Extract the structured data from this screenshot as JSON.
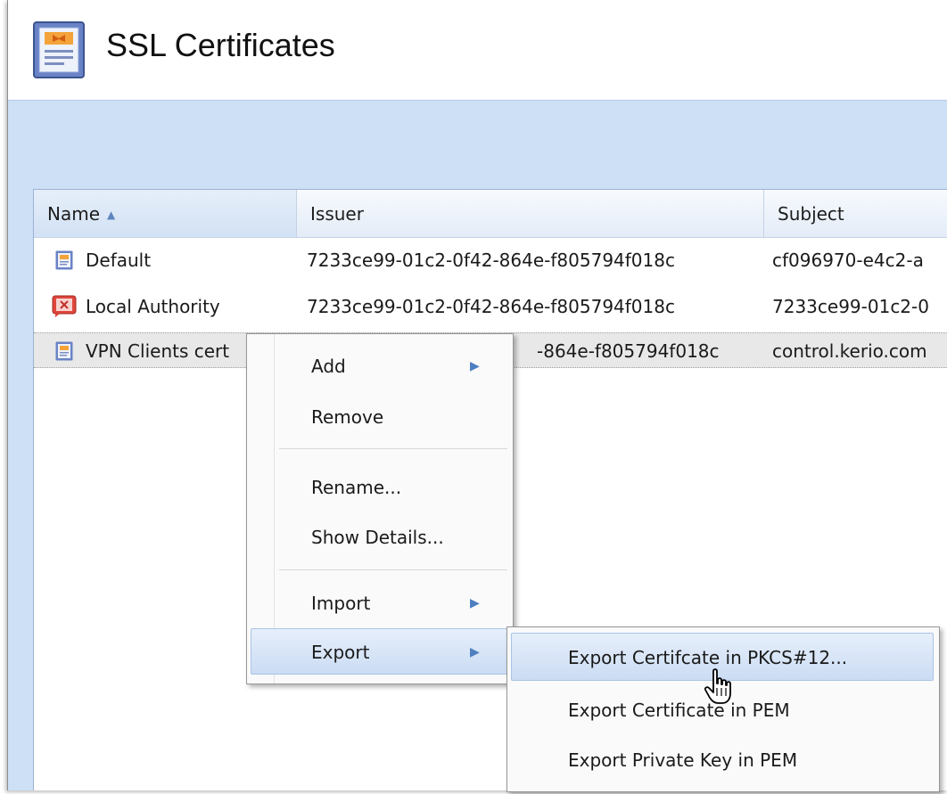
{
  "header": {
    "title": "SSL Certificates",
    "icon": "certificate-icon"
  },
  "grid": {
    "columns": [
      {
        "label": "Name",
        "sorted": "ascending"
      },
      {
        "label": "Issuer"
      },
      {
        "label": "Subject"
      }
    ],
    "rows": [
      {
        "icon": "certificate-icon",
        "name": "Default",
        "issuer": "7233ce99-01c2-0f42-864e-f805794f018c",
        "subject": "cf096970-e4c2-a",
        "selected": false
      },
      {
        "icon": "authority-certificate-icon",
        "name": "Local Authority",
        "issuer": "7233ce99-01c2-0f42-864e-f805794f018c",
        "subject": "7233ce99-01c2-0",
        "selected": false
      },
      {
        "icon": "certificate-icon",
        "name": "VPN Clients cert",
        "issuer": "-864e-f805794f018c",
        "subject": "control.kerio.com",
        "selected": true
      }
    ]
  },
  "context_menu": {
    "items": [
      {
        "label": "Add",
        "submenu": true
      },
      {
        "label": "Remove"
      },
      {
        "label": "Rename..."
      },
      {
        "label": "Show Details..."
      },
      {
        "label": "Import",
        "submenu": true
      },
      {
        "label": "Export",
        "submenu": true,
        "active": true
      }
    ]
  },
  "export_submenu": {
    "items": [
      {
        "label": "Export Certifcate in PKCS#12...",
        "active": true
      },
      {
        "label": "Export Certificate in PEM"
      },
      {
        "label": "Export Private Key in PEM"
      }
    ]
  },
  "colors": {
    "toolbar_bg": "#cde0f6",
    "selection_bg": "#cbdcf3",
    "submenu_arrow": "#4d7fc1"
  },
  "cursor": "hand-pointer-icon"
}
